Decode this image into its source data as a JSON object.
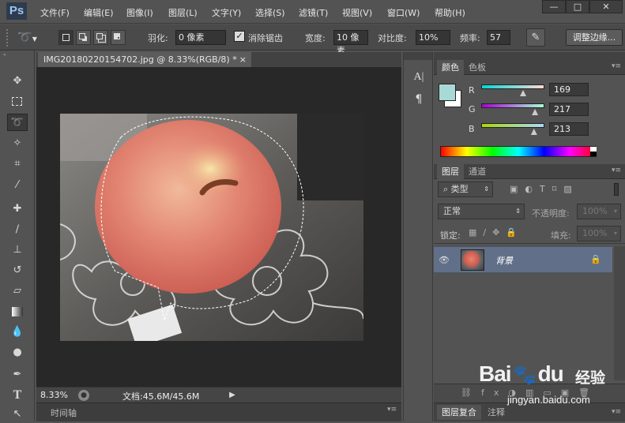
{
  "app": {
    "logo": "Ps"
  },
  "menu": [
    "文件(F)",
    "编辑(E)",
    "图像(I)",
    "图层(L)",
    "文字(Y)",
    "选择(S)",
    "滤镜(T)",
    "视图(V)",
    "窗口(W)",
    "帮助(H)"
  ],
  "window_controls": {
    "minimize": "—",
    "maximize": "□",
    "close": "✕"
  },
  "options": {
    "feather_label": "羽化:",
    "feather_value": "0 像素",
    "antialias_label": "消除锯齿",
    "width_label": "宽度:",
    "width_value": "10 像素",
    "contrast_label": "对比度:",
    "contrast_value": "10%",
    "frequency_label": "频率:",
    "frequency_value": "57",
    "refine_edge": "调整边缘..."
  },
  "document": {
    "tab_title": "IMG20180220154702.jpg @ 8.33%(RGB/8) *",
    "close": "×",
    "zoom": "8.33%",
    "doc_info": "文档:45.6M/45.6M"
  },
  "timeline_label": "时间轴",
  "color_panel": {
    "tabs": [
      "颜色",
      "色板"
    ],
    "r_label": "R",
    "g_label": "G",
    "b_label": "B",
    "r": "169",
    "g": "217",
    "b": "213",
    "fg_color": "#a9d9d5"
  },
  "layers_panel": {
    "tabs": [
      "图层",
      "通道"
    ],
    "filter_kind": "类型",
    "blend_mode": "正常",
    "opacity_label": "不透明度:",
    "opacity_value": "100%",
    "lock_label": "锁定:",
    "fill_label": "填充:",
    "fill_value": "100%",
    "layer_name": "背景"
  },
  "bottom_tabs": [
    "图层复合",
    "注释"
  ],
  "watermark": {
    "brand": "Bai",
    "brand2": "du",
    "jingyan": "经验",
    "url": "jingyan.baidu.com"
  }
}
